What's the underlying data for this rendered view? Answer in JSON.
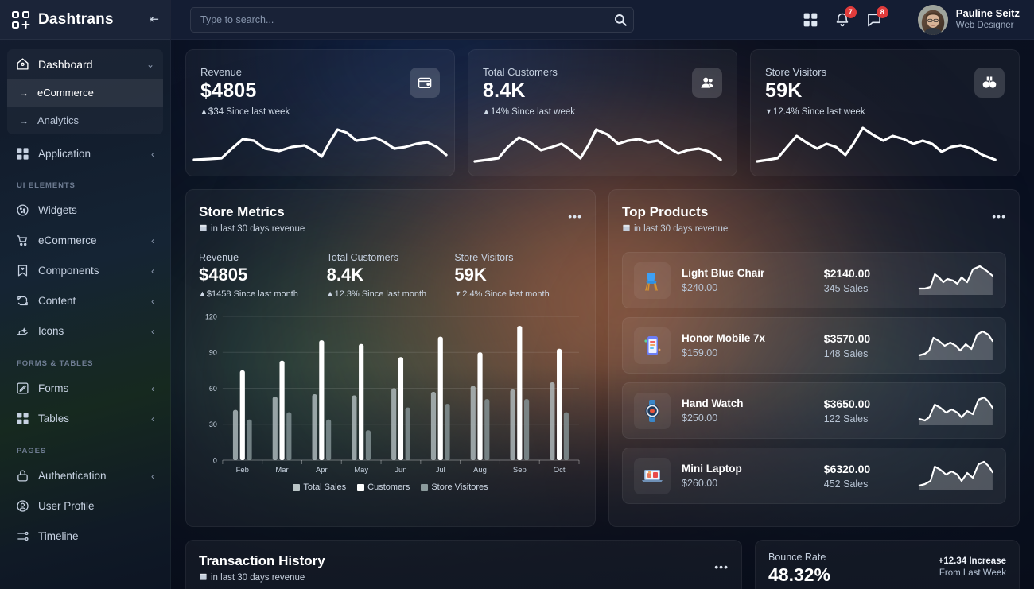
{
  "brand": {
    "name": "Dashtrans",
    "logo_icon": "grid-cross-logo-icon",
    "collapse_icon": "collapse-sidebar-icon",
    "collapse_glyph": "⇤"
  },
  "sidebar": {
    "dashboard": {
      "label": "Dashboard",
      "icon": "home-icon",
      "caret": "⌄",
      "children": [
        {
          "label": "eCommerce",
          "arrow": "→",
          "active": true
        },
        {
          "label": "Analytics",
          "arrow": "→",
          "active": false
        }
      ]
    },
    "application": {
      "label": "Application",
      "icon": "grid-apps-icon",
      "caret": "‹"
    },
    "sections": [
      {
        "title": "UI ELEMENTS",
        "items": [
          {
            "label": "Widgets",
            "icon": "cookie-icon",
            "caret": ""
          },
          {
            "label": "eCommerce",
            "icon": "shopping-cart-icon",
            "caret": "‹"
          },
          {
            "label": "Components",
            "icon": "bookmark-heart-icon",
            "caret": "‹"
          },
          {
            "label": "Content",
            "icon": "content-repeat-icon",
            "caret": "‹"
          },
          {
            "label": "Icons",
            "icon": "hand-sparkle-icon",
            "caret": "‹"
          }
        ]
      },
      {
        "title": "FORMS & TABLES",
        "items": [
          {
            "label": "Forms",
            "icon": "pencil-square-icon",
            "caret": "‹"
          },
          {
            "label": "Tables",
            "icon": "table-grid-icon",
            "caret": "‹"
          }
        ]
      },
      {
        "title": "PAGES",
        "items": [
          {
            "label": "Authentication",
            "icon": "lock-icon",
            "caret": "‹"
          },
          {
            "label": "User Profile",
            "icon": "user-circle-icon",
            "caret": ""
          },
          {
            "label": "Timeline",
            "icon": "timeline-icon",
            "caret": ""
          }
        ]
      }
    ]
  },
  "header": {
    "search_placeholder": "Type to search...",
    "search_value": "",
    "search_icon": "search-icon",
    "apps_icon": "grid-apps-icon",
    "notifications": {
      "icon": "bell-icon",
      "count": "7"
    },
    "messages": {
      "icon": "chat-bubble-icon",
      "count": "8"
    },
    "user": {
      "name": "Pauline Seitz",
      "role": "Web Designer",
      "avatar": "user-avatar"
    }
  },
  "stat_cards": [
    {
      "label": "Revenue",
      "value": "$4805",
      "delta_dir": "▲",
      "delta": "$34 Since last week",
      "icon": "wallet-icon"
    },
    {
      "label": "Total Customers",
      "value": "8.4K",
      "delta_dir": "▲",
      "delta": "14% Since last week",
      "icon": "users-icon"
    },
    {
      "label": "Store Visitors",
      "value": "59K",
      "delta_dir": "▼",
      "delta": "12.4% Since last week",
      "icon": "binoculars-icon"
    }
  ],
  "store_metrics": {
    "title": "Store Metrics",
    "subtitle": "in last 30 days revenue",
    "subtitle_icon": "calendar-icon",
    "menu_icon": "more-options-icon",
    "menu_glyph": "•••",
    "stats": [
      {
        "label": "Revenue",
        "value": "$4805",
        "delta_dir": "▲",
        "delta": "$1458 Since last month"
      },
      {
        "label": "Total Customers",
        "value": "8.4K",
        "delta_dir": "▲",
        "delta": "12.3% Since last month"
      },
      {
        "label": "Store Visitors",
        "value": "59K",
        "delta_dir": "▼",
        "delta": "2.4% Since last month"
      }
    ]
  },
  "chart_data": {
    "type": "bar",
    "title": "Store Metrics",
    "xlabel": "",
    "ylabel": "",
    "ylim": [
      0,
      120
    ],
    "yticks": [
      0,
      30,
      60,
      90,
      120
    ],
    "grid": true,
    "legend_position": "bottom",
    "categories": [
      "Feb",
      "Mar",
      "Apr",
      "May",
      "Jun",
      "Jul",
      "Aug",
      "Sep",
      "Oct"
    ],
    "series": [
      {
        "name": "Total Sales",
        "color": "#b9c4c6",
        "values": [
          42,
          53,
          55,
          54,
          60,
          57,
          62,
          59,
          65
        ]
      },
      {
        "name": "Customers",
        "color": "#ffffff",
        "values": [
          75,
          83,
          100,
          97,
          86,
          103,
          90,
          112,
          93
        ]
      },
      {
        "name": "Store Visitores",
        "color": "#8b9a9c",
        "values": [
          34,
          40,
          34,
          25,
          44,
          47,
          51,
          51,
          40
        ]
      }
    ]
  },
  "top_products": {
    "title": "Top Products",
    "subtitle": "in last 30 days revenue",
    "subtitle_icon": "calendar-icon",
    "menu_glyph": "•••",
    "items": [
      {
        "name": "Light Blue Chair",
        "price": "$240.00",
        "amount": "$2140.00",
        "sales": "345 Sales",
        "thumb": "chair-icon"
      },
      {
        "name": "Honor Mobile 7x",
        "price": "$159.00",
        "amount": "$3570.00",
        "sales": "148 Sales",
        "thumb": "mobile-phone-icon"
      },
      {
        "name": "Hand Watch",
        "price": "$250.00",
        "amount": "$3650.00",
        "sales": "122 Sales",
        "thumb": "watch-icon"
      },
      {
        "name": "Mini Laptop",
        "price": "$260.00",
        "amount": "$6320.00",
        "sales": "452 Sales",
        "thumb": "laptop-icon"
      }
    ]
  },
  "transaction_history": {
    "title": "Transaction History",
    "subtitle": "in last 30 days revenue",
    "subtitle_icon": "calendar-icon",
    "menu_glyph": "•••"
  },
  "bounce_rate": {
    "label": "Bounce Rate",
    "value": "48.32%",
    "increase": "+12.34 Increase",
    "period": "From Last Week"
  },
  "colors": {
    "accent_orange": "#e88a52",
    "accent_green": "#487650",
    "accent_blue": "#22488c",
    "badge_red": "#e03b3b",
    "sidebar_bg": "#141c30",
    "header_bg": "#141d33"
  }
}
